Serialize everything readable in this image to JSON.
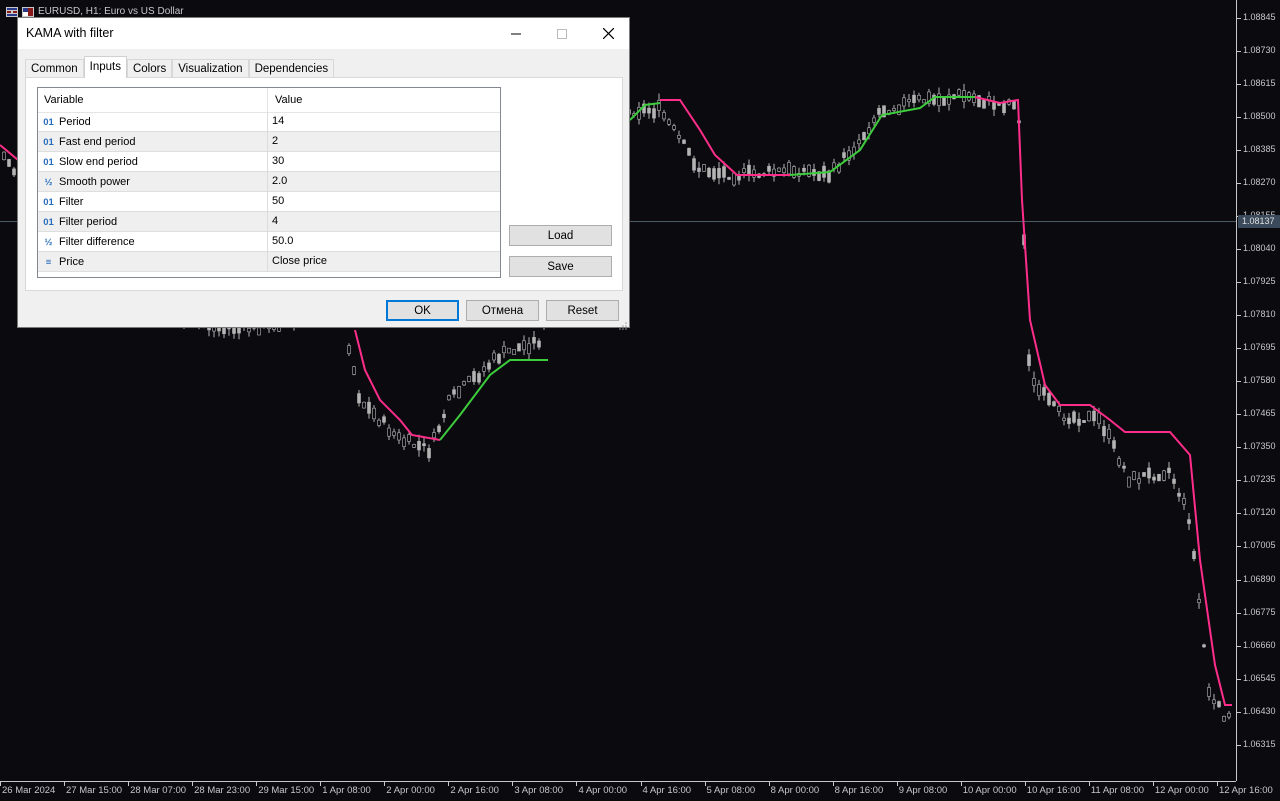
{
  "chart": {
    "symbol_title": "EURUSD, H1:  Euro vs US Dollar",
    "prices": [
      "1.08845",
      "1.08730",
      "1.08615",
      "1.08500",
      "1.08385",
      "1.08270",
      "1.08155",
      "1.08040",
      "1.07925",
      "1.07810",
      "1.07695",
      "1.07580",
      "1.07465",
      "1.07350",
      "1.07235",
      "1.07120",
      "1.07005",
      "1.06890",
      "1.06775",
      "1.06660",
      "1.06545",
      "1.06430",
      "1.06315"
    ],
    "current_price": "1.08137",
    "times": [
      "26 Mar 2024",
      "27 Mar 15:00",
      "28 Mar 07:00",
      "28 Mar 23:00",
      "29 Mar 15:00",
      "1 Apr 08:00",
      "2 Apr 00:00",
      "2 Apr 16:00",
      "3 Apr 08:00",
      "4 Apr 00:00",
      "4 Apr 16:00",
      "5 Apr 08:00",
      "8 Apr 00:00",
      "8 Apr 16:00",
      "9 Apr 08:00",
      "10 Apr 00:00",
      "10 Apr 16:00",
      "11 Apr 08:00",
      "12 Apr 00:00",
      "12 Apr 16:00"
    ],
    "colors": {
      "background": "#0a0a0f",
      "candle": "#b4b4b4",
      "kama_down": "#ff2d8a",
      "kama_up": "#3ccc3c"
    }
  },
  "dialog": {
    "title": "KAMA with filter",
    "tabs": [
      "Common",
      "Inputs",
      "Colors",
      "Visualization",
      "Dependencies"
    ],
    "active_tab": "Inputs",
    "columns": {
      "variable": "Variable",
      "value": "Value"
    },
    "inputs": [
      {
        "type": "01",
        "icon": "integer-icon",
        "name": "Period",
        "value": "14"
      },
      {
        "type": "01",
        "icon": "integer-icon",
        "name": "Fast end period",
        "value": "2"
      },
      {
        "type": "01",
        "icon": "integer-icon",
        "name": "Slow end period",
        "value": "30"
      },
      {
        "type": "½",
        "icon": "double-icon",
        "name": "Smooth power",
        "value": "2.0"
      },
      {
        "type": "01",
        "icon": "integer-icon",
        "name": "Filter",
        "value": "50"
      },
      {
        "type": "01",
        "icon": "integer-icon",
        "name": "Filter period",
        "value": "4"
      },
      {
        "type": "½",
        "icon": "double-icon",
        "name": "Filter difference",
        "value": "50.0"
      },
      {
        "type": "≡",
        "icon": "enum-icon",
        "name": "Price",
        "value": "Close price"
      }
    ],
    "buttons": {
      "load": "Load",
      "save": "Save",
      "ok": "OK",
      "cancel": "Отмена",
      "reset": "Reset"
    }
  }
}
